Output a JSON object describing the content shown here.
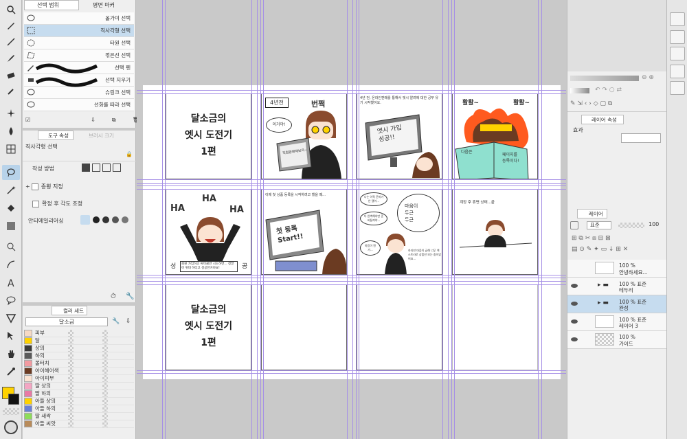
{
  "sub_tool": {
    "tabs": [
      "선택 범위",
      "평면 마커"
    ],
    "items": [
      "올가미 선택",
      "직사각형 선택",
      "타원 선택",
      "꺾은선 선택",
      "선택 펜",
      "선택 지우기",
      "슈링크 선택",
      "선화를 따라 선택"
    ]
  },
  "tool_property": {
    "tabs": [
      "도구 속성",
      "브러시 크기"
    ],
    "tool_name": "직사각형 선택",
    "rows": {
      "method": "작성 방법",
      "aspect": "종횡 지정",
      "angle": "확정 후 각도 조정",
      "antialias": "안티에일리어싱"
    }
  },
  "color_set": {
    "tabs": [
      "컬러 세트"
    ],
    "set_name": "달소금",
    "swatches": [
      {
        "name": "피부",
        "color": "#f6d9c4"
      },
      {
        "name": "달",
        "color": "#ffd200"
      },
      {
        "name": "상의",
        "color": "#3a3a3a"
      },
      {
        "name": "하의",
        "color": "#5a5a5a"
      },
      {
        "name": "볼터치",
        "color": "#f29aa0"
      },
      {
        "name": "아이헤어색",
        "color": "#6b3b22"
      },
      {
        "name": "아이피부",
        "color": "#fbe3d2"
      },
      {
        "name": "딸 상의",
        "color": "#f4a6c3"
      },
      {
        "name": "딸 하의",
        "color": "#e87aa5"
      },
      {
        "name": "아들 상의",
        "color": "#ffd200"
      },
      {
        "name": "아들 하의",
        "color": "#6a7fd8"
      },
      {
        "name": "딸 새싹",
        "color": "#8edc5a"
      },
      {
        "name": "아들 씨앗",
        "color": "#b88b5a"
      }
    ],
    "main_color": "#ffd200",
    "sub_color": "#111111"
  },
  "comic": {
    "title_lines": [
      "달소금의",
      "엣시 도전기",
      "1편"
    ],
    "p2_box": "4년전",
    "p2_sfx": "번쩍",
    "p2_bubble": "이거야!",
    "p2_screen": "직접판매해보자~",
    "p3_caption": "4년 전, 온라인판매를 통해서 엣시 알려에 대한 공부 유기 시작했어요.",
    "p3_screen": [
      "엣시 가입",
      "성공!!"
    ],
    "p4_sfx1": "활활~",
    "p4_sfx2": "활활~",
    "p4_book": [
      "다음은",
      "페이지를",
      "등록이다!"
    ],
    "p5_ha": [
      "HA",
      "HA",
      "HA"
    ],
    "p5_side": [
      "성",
      "공"
    ],
    "p5_caption": "회원 가입하고 싸이클만 시도하면... 정말 아 위대 하다고 성공한거야요!",
    "p6_caption": "이제 첫 상품 등록을 시작하려고 했을 때...",
    "p6_screen": [
      "첫 등록",
      "Start!!"
    ],
    "p7_bubble1": "나는 아직 준비가 안 됐어...",
    "p7_bubble2": "다 완벽해야만 준비될꺼야...",
    "p7_bubble3": "마음이 뭔가...",
    "p7_thought": [
      "마음이",
      "두근",
      "두근"
    ],
    "p7_caption": "하지만 마음이 급해 너무 엑스트라로 상품만 보는 중이었어요...",
    "p8_caption": "계정 후 휴면 상태...끝"
  },
  "nav": {
    "layer_property_tab": "레이어 속성",
    "effect_label": "효과"
  },
  "layer_panel": {
    "tab": "레이어",
    "blend": "표준",
    "opacity": "100",
    "layers": [
      {
        "line1": "100 %",
        "line2": "안녕하세요..."
      },
      {
        "line1": "100 % 표준",
        "line2": "테두리"
      },
      {
        "line1": "100 % 표준",
        "line2": "완성"
      },
      {
        "line1": "100 % 표준",
        "line2": "레이어 3"
      },
      {
        "line1": "100 %",
        "line2": "가이드"
      }
    ]
  }
}
